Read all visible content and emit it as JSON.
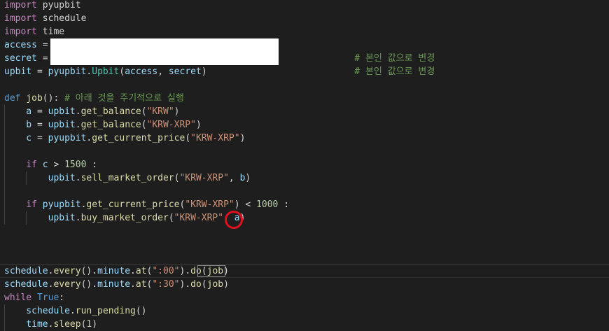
{
  "editor": {
    "lines": [
      [
        {
          "t": "import",
          "c": "ctl"
        },
        {
          "t": " pyupbit",
          "c": "pl"
        }
      ],
      [
        {
          "t": "import",
          "c": "ctl"
        },
        {
          "t": " schedule",
          "c": "pl"
        }
      ],
      [
        {
          "t": "import",
          "c": "ctl"
        },
        {
          "t": " time",
          "c": "pl"
        }
      ],
      [
        {
          "t": "access",
          "c": "var"
        },
        {
          "t": " = ",
          "c": "pl"
        }
      ],
      [
        {
          "t": "secret",
          "c": "var"
        },
        {
          "t": " = ",
          "c": "pl"
        }
      ],
      [
        {
          "t": "upbit",
          "c": "var"
        },
        {
          "t": " = ",
          "c": "pl"
        },
        {
          "t": "pyupbit",
          "c": "var"
        },
        {
          "t": ".",
          "c": "pl"
        },
        {
          "t": "Upbit",
          "c": "cls"
        },
        {
          "t": "(",
          "c": "pl"
        },
        {
          "t": "access",
          "c": "var"
        },
        {
          "t": ", ",
          "c": "pl"
        },
        {
          "t": "secret",
          "c": "var"
        },
        {
          "t": ")",
          "c": "pl"
        }
      ],
      [],
      [
        {
          "t": "def",
          "c": "kw"
        },
        {
          "t": " ",
          "c": "pl"
        },
        {
          "t": "job",
          "c": "fn"
        },
        {
          "t": "(): ",
          "c": "pl"
        },
        {
          "t": "# 아래 것을 주기적으로 실행",
          "c": "cmt"
        }
      ],
      [
        {
          "t": "    a",
          "c": "var"
        },
        {
          "t": " = ",
          "c": "pl"
        },
        {
          "t": "upbit",
          "c": "var"
        },
        {
          "t": ".",
          "c": "pl"
        },
        {
          "t": "get_balance",
          "c": "fn"
        },
        {
          "t": "(",
          "c": "pl"
        },
        {
          "t": "\"KRW\"",
          "c": "str"
        },
        {
          "t": ")",
          "c": "pl"
        }
      ],
      [
        {
          "t": "    b",
          "c": "var"
        },
        {
          "t": " = ",
          "c": "pl"
        },
        {
          "t": "upbit",
          "c": "var"
        },
        {
          "t": ".",
          "c": "pl"
        },
        {
          "t": "get_balance",
          "c": "fn"
        },
        {
          "t": "(",
          "c": "pl"
        },
        {
          "t": "\"KRW-XRP\"",
          "c": "str"
        },
        {
          "t": ")",
          "c": "pl"
        }
      ],
      [
        {
          "t": "    c",
          "c": "var"
        },
        {
          "t": " = ",
          "c": "pl"
        },
        {
          "t": "pyupbit",
          "c": "var"
        },
        {
          "t": ".",
          "c": "pl"
        },
        {
          "t": "get_current_price",
          "c": "fn"
        },
        {
          "t": "(",
          "c": "pl"
        },
        {
          "t": "\"KRW-XRP\"",
          "c": "str"
        },
        {
          "t": ")",
          "c": "pl"
        }
      ],
      [],
      [
        {
          "t": "    if",
          "c": "ctl"
        },
        {
          "t": " ",
          "c": "pl"
        },
        {
          "t": "c",
          "c": "var"
        },
        {
          "t": " > ",
          "c": "pl"
        },
        {
          "t": "1500",
          "c": "num"
        },
        {
          "t": " :",
          "c": "pl"
        }
      ],
      [
        {
          "t": "        upbit",
          "c": "var"
        },
        {
          "t": ".",
          "c": "pl"
        },
        {
          "t": "sell_market_order",
          "c": "fn"
        },
        {
          "t": "(",
          "c": "pl"
        },
        {
          "t": "\"KRW-XRP\"",
          "c": "str"
        },
        {
          "t": ", ",
          "c": "pl"
        },
        {
          "t": "b",
          "c": "var"
        },
        {
          "t": ")",
          "c": "pl"
        }
      ],
      [],
      [
        {
          "t": "    if",
          "c": "ctl"
        },
        {
          "t": " ",
          "c": "pl"
        },
        {
          "t": "pyupbit",
          "c": "var"
        },
        {
          "t": ".",
          "c": "pl"
        },
        {
          "t": "get_current_price",
          "c": "fn"
        },
        {
          "t": "(",
          "c": "pl"
        },
        {
          "t": "\"KRW-XRP\"",
          "c": "str"
        },
        {
          "t": ") < ",
          "c": "pl"
        },
        {
          "t": "1000",
          "c": "num"
        },
        {
          "t": " :",
          "c": "pl"
        }
      ],
      [
        {
          "t": "        upbit",
          "c": "var"
        },
        {
          "t": ".",
          "c": "pl"
        },
        {
          "t": "buy_market_order",
          "c": "fn"
        },
        {
          "t": "(",
          "c": "pl"
        },
        {
          "t": "\"KRW-XRP\"",
          "c": "str"
        },
        {
          "t": ", ",
          "c": "pl"
        },
        {
          "t": "a",
          "c": "var"
        },
        {
          "t": ")",
          "c": "pl"
        }
      ],
      [],
      [],
      [],
      [
        {
          "t": "schedule",
          "c": "var"
        },
        {
          "t": ".",
          "c": "pl"
        },
        {
          "t": "every",
          "c": "fn"
        },
        {
          "t": "().",
          "c": "pl"
        },
        {
          "t": "minute",
          "c": "var"
        },
        {
          "t": ".",
          "c": "pl"
        },
        {
          "t": "at",
          "c": "fn"
        },
        {
          "t": "(",
          "c": "pl"
        },
        {
          "t": "\":00\"",
          "c": "str"
        },
        {
          "t": ").",
          "c": "pl"
        },
        {
          "t": "do",
          "c": "fn"
        },
        {
          "t": "(",
          "c": "pl"
        },
        {
          "t": "job",
          "c": "fn"
        },
        {
          "t": ")",
          "c": "pl"
        }
      ],
      [
        {
          "t": "schedule",
          "c": "var"
        },
        {
          "t": ".",
          "c": "pl"
        },
        {
          "t": "every",
          "c": "fn"
        },
        {
          "t": "().",
          "c": "pl"
        },
        {
          "t": "minute",
          "c": "var"
        },
        {
          "t": ".",
          "c": "pl"
        },
        {
          "t": "at",
          "c": "fn"
        },
        {
          "t": "(",
          "c": "pl"
        },
        {
          "t": "\":30\"",
          "c": "str"
        },
        {
          "t": ").",
          "c": "pl"
        },
        {
          "t": "do",
          "c": "fn"
        },
        {
          "t": "(",
          "c": "pl"
        },
        {
          "t": "job",
          "c": "fn"
        },
        {
          "t": ")",
          "c": "pl"
        }
      ],
      [
        {
          "t": "while",
          "c": "ctl"
        },
        {
          "t": " ",
          "c": "pl"
        },
        {
          "t": "True",
          "c": "kw"
        },
        {
          "t": ":",
          "c": "pl"
        }
      ],
      [
        {
          "t": "    schedule",
          "c": "var"
        },
        {
          "t": ".",
          "c": "pl"
        },
        {
          "t": "run_pending",
          "c": "fn"
        },
        {
          "t": "()",
          "c": "pl"
        }
      ],
      [
        {
          "t": "    time",
          "c": "var"
        },
        {
          "t": ".",
          "c": "pl"
        },
        {
          "t": "sleep",
          "c": "fn"
        },
        {
          "t": "(",
          "c": "pl"
        },
        {
          "t": "1",
          "c": "num"
        },
        {
          "t": ")",
          "c": "pl"
        }
      ]
    ],
    "side_comments": {
      "access_comment": "# 본인 값으로 변경",
      "secret_comment": "# 본인 값으로 변경"
    },
    "colors": {
      "background": "#1e1e1e",
      "keyword": "#569cd6",
      "control": "#c586c0",
      "function": "#dcdcaa",
      "variable": "#9cdcfe",
      "string": "#ce9178",
      "number": "#b5cea8",
      "comment": "#6a9955",
      "class": "#4ec9b0",
      "annotation_circle": "#e0101e"
    }
  }
}
